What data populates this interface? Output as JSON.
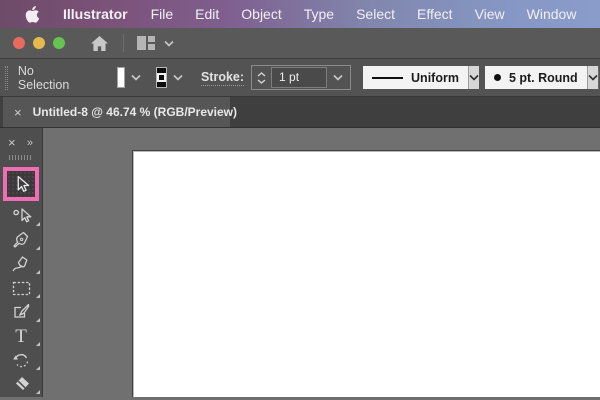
{
  "menubar": {
    "items": [
      "Illustrator",
      "File",
      "Edit",
      "Object",
      "Type",
      "Select",
      "Effect",
      "View",
      "Window"
    ]
  },
  "titlebar": {
    "traffic_lights": [
      "close",
      "minimize",
      "zoom"
    ]
  },
  "controlbar": {
    "selection_status": "No Selection",
    "fill_color": "#ffffff",
    "stroke_color": "#000000",
    "stroke_label": "Stroke:",
    "stroke_weight": "1 pt",
    "variable_width_profile": "Uniform",
    "brush_definition": "5 pt. Round"
  },
  "tabbar": {
    "close_glyph": "×",
    "title": "Untitled-8 @ 46.74 % (RGB/Preview)"
  },
  "toolbar": {
    "close_glyph": "×",
    "expand_glyph": "»",
    "tools": [
      {
        "name": "selection",
        "active": true
      },
      {
        "name": "direct-selection",
        "active": false
      },
      {
        "name": "pen",
        "active": false
      },
      {
        "name": "curvature",
        "active": false
      },
      {
        "name": "rectangle",
        "active": false
      },
      {
        "name": "paintbrush",
        "active": false
      },
      {
        "name": "type",
        "active": false,
        "glyph": "T"
      },
      {
        "name": "rotate",
        "active": false
      },
      {
        "name": "eraser",
        "active": false
      }
    ]
  },
  "colors": {
    "accent_pink": "#f06eb4",
    "menubar_left": "#6e4b69",
    "menubar_right": "#8a9cc9",
    "titlebar_bg": "#595959",
    "controlbar_bg": "#535353",
    "tabbar_bg": "#3f3f3f",
    "tab_bg": "#565656",
    "toolbar_bg": "#4e4e4e",
    "pasteboard": "#707070",
    "artboard": "#ffffff",
    "traffic_red": "#e8695d",
    "traffic_yellow": "#e5b94e",
    "traffic_green": "#67c153"
  }
}
